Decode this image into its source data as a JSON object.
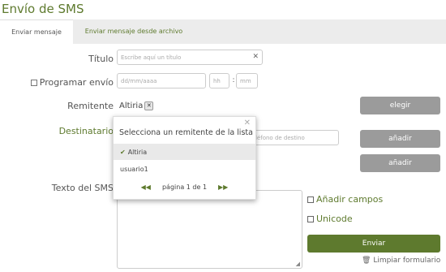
{
  "page": {
    "title": "Envío de SMS"
  },
  "tabs": [
    {
      "label": "Enviar mensaje",
      "active": true
    },
    {
      "label": "Enviar mensaje desde archivo",
      "active": false
    }
  ],
  "form": {
    "title_label": "Título",
    "title_placeholder": "Escribe aquí un título",
    "schedule_label": "Programar envío",
    "date_placeholder": "dd/mm/aaaa",
    "hour_placeholder": "hh",
    "time_sep": ":",
    "minute_placeholder": "mm",
    "sender_label": "Remitente",
    "sender_value": "Altiria",
    "choose_button": "elegir",
    "recipient_label": "Destinatario",
    "recipient_placeholder": "léfono de destino",
    "add_button_1": "añadir",
    "add_button_2": "añadir",
    "text_label": "Texto del SMS",
    "add_fields_label": "Añadir campos",
    "unicode_label": "Unicode",
    "send_button": "Enviar",
    "clear_form_label": "Limpiar formulario"
  },
  "popup": {
    "title": "Selecciona un remitente de la lista",
    "items": [
      {
        "label": "Altiria",
        "selected": true
      },
      {
        "label": "usuario1",
        "selected": false
      }
    ],
    "pager": "página 1 de 1"
  },
  "colors": {
    "accent": "#5e7a2e",
    "button_grey": "#9b9b9b"
  }
}
